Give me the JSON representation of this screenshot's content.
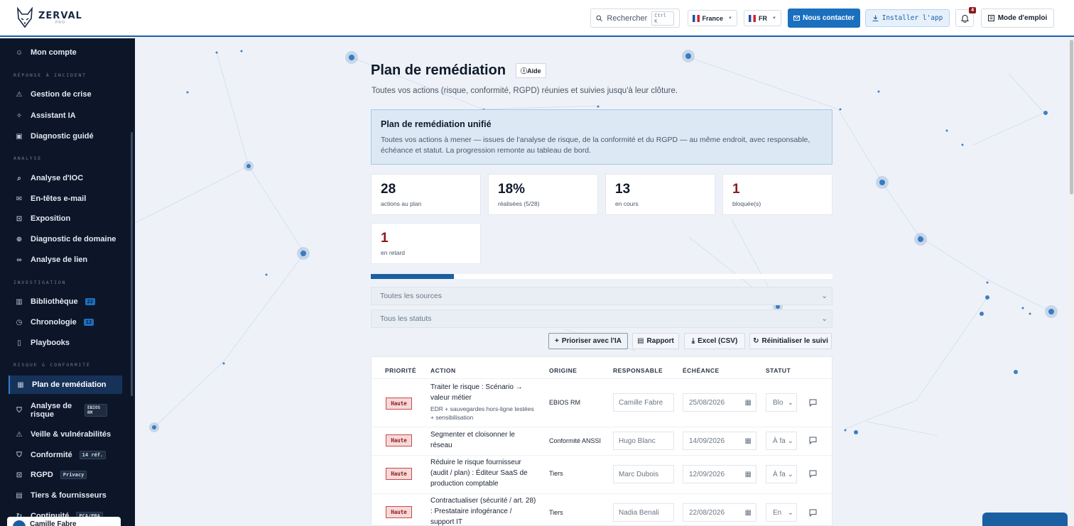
{
  "brand": {
    "name": "ZERVAL",
    "sub": "PRO"
  },
  "topbar": {
    "search_label": "Rechercher",
    "search_kbd": "Ctrl K",
    "country": "France",
    "language": "FR",
    "contact_label": "Nous contacter",
    "install_label": "Installer l'app",
    "notif_count": "4",
    "mode_label": "Mode d'emploi"
  },
  "sidebar": {
    "account": "Mon compte",
    "sections": {
      "incident": "RÉPONSE À INCIDENT",
      "analyse": "ANALYSE",
      "investigation": "INVESTIGATION",
      "risque": "RISQUE & CONFORMITÉ"
    },
    "items": {
      "crise": "Gestion de crise",
      "ia": "Assistant IA",
      "diag": "Diagnostic guidé",
      "ioc": "Analyse d'IOC",
      "entetes": "En-têtes e-mail",
      "expo": "Exposition",
      "domaine": "Diagnostic de domaine",
      "lien": "Analyse de lien",
      "biblio": "Bibliothèque",
      "biblio_count": "22",
      "chrono": "Chronologie",
      "chrono_count": "12",
      "playbooks": "Playbooks",
      "plan": "Plan de remédiation",
      "risque": "Analyse de risque",
      "risque_tag": "EBIOS RM",
      "veille": "Veille & vulnérabilités",
      "conf": "Conformité",
      "conf_tag": "14 réf.",
      "rgpd": "RGPD",
      "rgpd_tag": "Privacy",
      "tiers": "Tiers & fournisseurs",
      "cont": "Continuité",
      "cont_tag": "PCA/PRA"
    },
    "user": "Camille Fabre"
  },
  "main": {
    "title": "Plan de remédiation",
    "help": "Aide",
    "subtitle": "Toutes vos actions (risque, conformité, RGPD) réunies et suivies jusqu'à leur clôture.",
    "info_title": "Plan de remédiation unifié",
    "info_text": "Toutes vos actions à mener — issues de l'analyse de risque, de la conformité et du RGPD — au même endroit, avec responsable, échéance et statut. La progression remonte au tableau de bord.",
    "stats": [
      {
        "value": "28",
        "label": "actions au plan"
      },
      {
        "value": "18%",
        "label": "réalisées (5/28)"
      },
      {
        "value": "13",
        "label": "en cours"
      },
      {
        "value": "1",
        "label": "bloquée(s)"
      },
      {
        "value": "1",
        "label": "en retard"
      }
    ],
    "progress": 0.18,
    "filter_sources": "Toutes les sources",
    "filter_status": "Tous les statuts",
    "buttons": {
      "ia": "Prioriser avec l'IA",
      "rapport": "Rapport",
      "excel": "Excel (CSV)",
      "reset": "Réinitialiser le suivi"
    },
    "columns": [
      "PRIORITÉ",
      "ACTION",
      "ORIGINE",
      "RESPONSABLE",
      "ÉCHÉANCE",
      "STATUT"
    ],
    "rows": [
      {
        "priority": "Haute",
        "action": "Traiter le risque : Scénario → valeur métier",
        "detail": "EDR + sauvegardes hors-ligne testées + sensibilisation",
        "origin": "EBIOS RM",
        "owner": "Camille Fabre",
        "due": "25/08/2026",
        "status": "Blo"
      },
      {
        "priority": "Haute",
        "action": "Segmenter et cloisonner le réseau",
        "detail": "",
        "origin": "Conformité ANSSI",
        "owner": "Hugo Blanc",
        "due": "14/09/2026",
        "status": "À fa"
      },
      {
        "priority": "Haute",
        "action": "Réduire le risque fournisseur (audit / plan) : Éditeur SaaS de production comptable",
        "detail": "",
        "origin": "Tiers",
        "owner": "Marc Dubois",
        "due": "12/09/2026",
        "status": "À fa"
      },
      {
        "priority": "Haute",
        "action": "Contractualiser (sécurité / art. 28) : Prestataire infogérance / support IT",
        "detail": "",
        "origin": "Tiers",
        "owner": "Nadia Benali",
        "due": "22/08/2026",
        "status": "En"
      }
    ]
  }
}
